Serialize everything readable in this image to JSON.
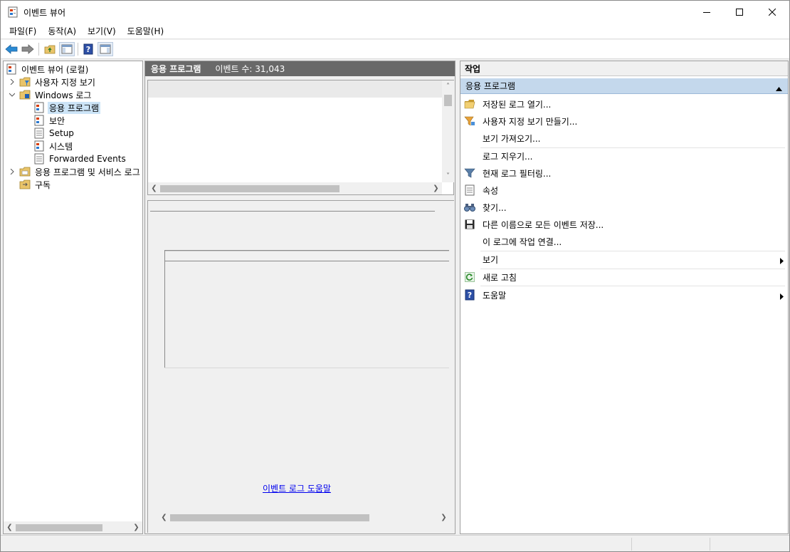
{
  "window": {
    "title": "이벤트 뷰어",
    "controls": {
      "minimize": "minimize",
      "maximize": "maximize",
      "close": "close"
    }
  },
  "menu": {
    "items": [
      "파일(F)",
      "동작(A)",
      "보기(V)",
      "도움말(H)"
    ]
  },
  "toolbar": {
    "buttons": [
      "back-icon",
      "forward-icon",
      "up-folder-icon",
      "show-hide-tree-icon",
      "help-icon",
      "show-hide-action-pane-icon"
    ]
  },
  "tree": {
    "root": "이벤트 뷰어 (로컬)",
    "custom_views": "사용자 지정 보기",
    "windows_logs": "Windows 로그",
    "application": "응용 프로그램",
    "security": "보안",
    "setup": "Setup",
    "system": "시스템",
    "forwarded": "Forwarded Events",
    "apps_services": "응용 프로그램 및 서비스 로그",
    "subscriptions": "구독"
  },
  "middle": {
    "header_title": "응용 프로그램",
    "event_count": "이벤트 수: 31,043",
    "help_link": "이벤트 로그 도움말"
  },
  "actions": {
    "header": "작업",
    "section": "응용 프로그램",
    "open_saved": "저장된 로그 열기...",
    "create_view": "사용자 지정 보기 만들기...",
    "import_view": "보기 가져오기...",
    "clear_log": "로그 지우기...",
    "filter_log": "현재 로그 필터링...",
    "properties": "속성",
    "find": "찾기...",
    "save_all": "다른 이름으로 모든 이벤트 저장...",
    "attach_task": "이 로그에 작업 연결...",
    "view": "보기",
    "refresh": "새로 고침",
    "help": "도움말"
  },
  "colors": {
    "header_gray": "#696969",
    "section_blue": "#c4d8ec",
    "selected_blue": "#cce4f7",
    "link_blue": "#0000ee"
  }
}
